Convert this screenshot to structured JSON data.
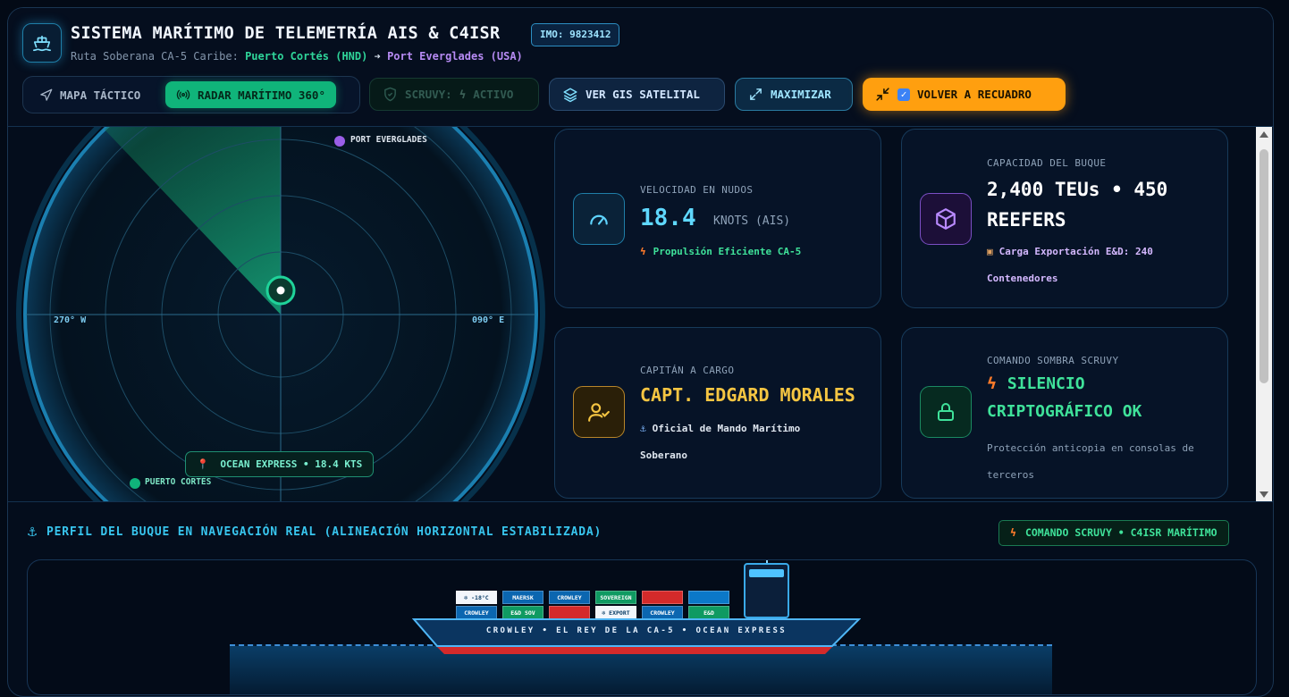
{
  "header": {
    "title": "SISTEMA MARÍTIMO DE TELEMETRÍA AIS & C4ISR",
    "imo": "IMO: 9823412",
    "route_prefix": "Ruta Soberana CA-5 Caribe:",
    "origin": "Puerto Cortés (HND)",
    "arrow": "➔",
    "destination": "Port Everglades (USA)"
  },
  "toolbar": {
    "tab_map": "MAPA TÁCTICO",
    "tab_radar": "RADAR MARÍTIMO 360°",
    "scruvy_label": "SCRUVY:",
    "scruvy_status": "ACTIVO",
    "gis": "VER GIS SATELITAL",
    "maximize": "MAXIMIZAR",
    "back": "VOLVER A RECUADRO"
  },
  "radar": {
    "port_top": "PORT EVERGLADES",
    "port_bottom": "PUERTO CORTÉS",
    "west": "270° W",
    "east": "090° E",
    "vessel_tag": "OCEAN EXPRESS • 18.4 KTS"
  },
  "cards": {
    "speed": {
      "label": "VELOCIDAD EN NUDOS",
      "value": "18.4",
      "unit": "KNOTS (AIS)",
      "note": "Propulsión Eficiente CA-5"
    },
    "capacity": {
      "label": "CAPACIDAD DEL BUQUE",
      "line1": "2,400 TEUs • 450",
      "line2": "REEFERS",
      "note1": "Carga Exportación E&D: 240",
      "note2": "Contenedores"
    },
    "captain": {
      "label": "CAPITÁN A CARGO",
      "name": "CAPT. EDGARD MORALES",
      "note1": "Oficial de Mando Marítimo",
      "note2": "Soberano"
    },
    "command": {
      "label": "COMANDO SOMBRA SCRUVY",
      "line1": "SILENCIO",
      "line2": "CRIPTOGRÁFICO OK",
      "note1": "Protección anticopia en consolas de",
      "note2": "terceros"
    }
  },
  "profile": {
    "title": "PERFIL DEL BUQUE EN NAVEGACIÓN REAL (ALINEACIÓN HORIZONTAL ESTABILIZADA)",
    "badge": "COMANDO SCRUVY • C4ISR MARÍTIMO",
    "hull_text": "CROWLEY • EL REY DE LA CA-5 • OCEAN EXPRESS",
    "containers_top": [
      "-18°C",
      "MAERSK",
      "CROWLEY",
      "SOVEREIGN",
      "",
      ""
    ],
    "containers_bottom": [
      "CROWLEY",
      "E&D SOV",
      "",
      "EXPORT",
      "CROWLEY",
      "E&D"
    ]
  },
  "colors": {
    "accent_cyan": "#38c5ee",
    "accent_green": "#10b47a",
    "accent_orange": "#ff9f0f",
    "accent_purple": "#a875f0",
    "accent_yellow": "#f5c542"
  }
}
